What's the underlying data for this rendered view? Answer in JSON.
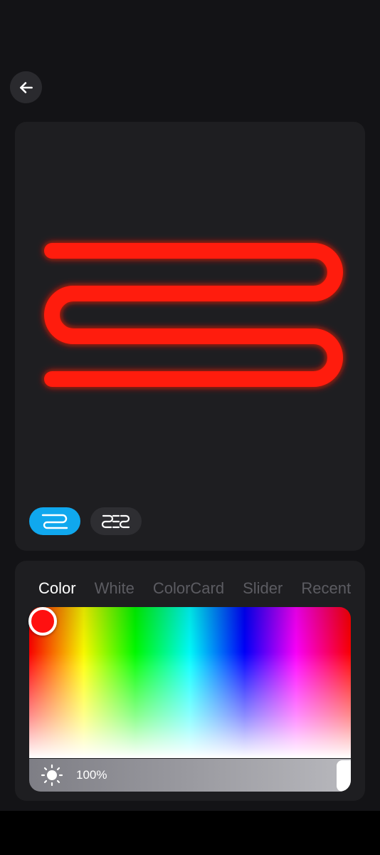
{
  "header": {
    "back_icon": "arrow-left-icon"
  },
  "preview": {
    "neon_color": "#ff0000",
    "modes": [
      {
        "name": "single-loop",
        "icon": "single-loop-icon",
        "active": true
      },
      {
        "name": "double-loop",
        "icon": "double-loop-icon",
        "active": false
      }
    ]
  },
  "tabs": [
    "Color",
    "White",
    "ColorCard",
    "Slider",
    "Recent"
  ],
  "active_tab": "Color",
  "picker": {
    "selected_color": "#ff0000"
  },
  "brightness": {
    "value_text": "100%",
    "level": 1.0,
    "icon": "brightness-sun-icon"
  },
  "colors": {
    "background": "#131316",
    "card": "#1e1e21",
    "accent": "#10a8ee"
  }
}
